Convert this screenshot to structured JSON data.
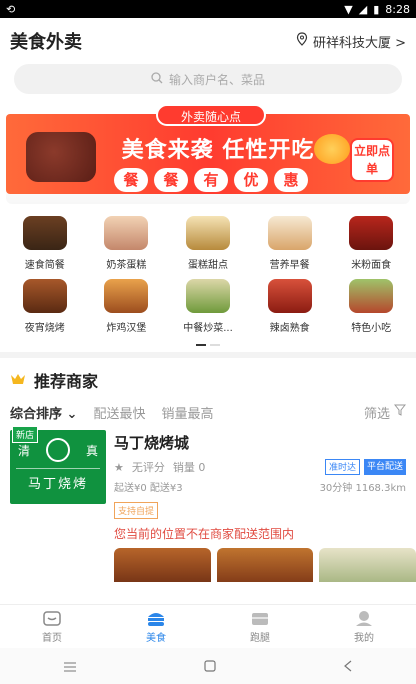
{
  "status_bar": {
    "time": "8:28"
  },
  "header": {
    "title": "美食外卖",
    "location": "研祥科技大厦 >"
  },
  "search": {
    "placeholder": "输入商户名、菜品"
  },
  "banner": {
    "tag": "外卖随心点",
    "headline": "美食来袭  任性开吃",
    "sub_chars": [
      "餐",
      "餐",
      "有",
      "优",
      "惠"
    ],
    "order_label": "立即点单"
  },
  "categories": [
    {
      "label": "速食简餐",
      "icon": "bento-icon"
    },
    {
      "label": "奶茶蛋糕",
      "icon": "milk-tea-icon"
    },
    {
      "label": "蛋糕甜点",
      "icon": "dessert-icon"
    },
    {
      "label": "营养早餐",
      "icon": "breakfast-icon"
    },
    {
      "label": "米粉面食",
      "icon": "noodles-icon"
    },
    {
      "label": "夜宵烧烤",
      "icon": "bbq-icon"
    },
    {
      "label": "炸鸡汉堡",
      "icon": "burger-icon"
    },
    {
      "label": "中餐炒菜...",
      "icon": "stir-fry-icon"
    },
    {
      "label": "辣卤熟食",
      "icon": "braised-icon"
    },
    {
      "label": "特色小吃",
      "icon": "snack-icon"
    }
  ],
  "recommend": {
    "title": "推荐商家",
    "sort": {
      "selected": "综合排序",
      "fast": "配送最快",
      "sales": "销量最高",
      "filter": "筛选"
    }
  },
  "shop": {
    "new_tag": "新店",
    "img_left": "清",
    "img_right": "真",
    "img_name": "马丁烧烤",
    "name": "马丁烧烤城",
    "rating": "无评分",
    "sales": "销量 0",
    "badge1": "准时达",
    "badge2": "平台配送",
    "min_order": "起送¥0",
    "delivery_fee": "配送¥3",
    "eta": "30分钟 1168.3km",
    "pay_tag": "支持自提",
    "warning": "您当前的位置不在商家配送范围内"
  },
  "tabs": [
    {
      "label": "首页",
      "icon": "home-icon"
    },
    {
      "label": "美食",
      "icon": "burger-tab-icon"
    },
    {
      "label": "跑腿",
      "icon": "errand-icon"
    },
    {
      "label": "我的",
      "icon": "profile-icon"
    }
  ],
  "active_tab": "美食",
  "colors": {
    "accent": "#2b86e9",
    "banner_red": "#ff3b2f",
    "green": "#10923f"
  }
}
